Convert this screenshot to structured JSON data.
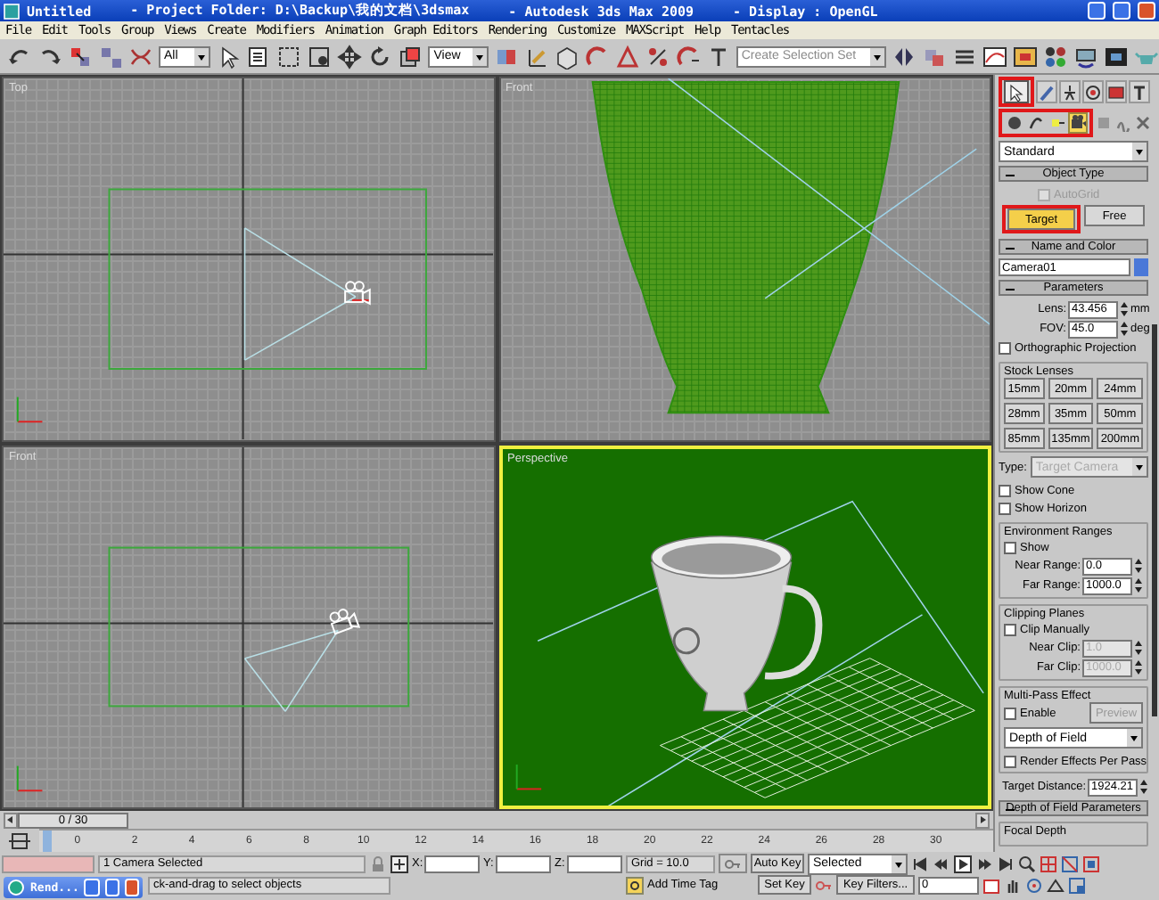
{
  "window": {
    "title_parts": [
      "Untitled",
      "- Project Folder: D:\\Backup\\我的文档\\3dsmax",
      "- Autodesk 3ds Max  2009",
      "- Display : OpenGL"
    ]
  },
  "menu": [
    "File",
    "Edit",
    "Tools",
    "Group",
    "Views",
    "Create",
    "Modifiers",
    "Animation",
    "Graph Editors",
    "Rendering",
    "Customize",
    "MAXScript",
    "Help",
    "Tentacles"
  ],
  "toolbar": {
    "selection_filter": "All",
    "reference_coordinates": "View",
    "selection_set": {
      "placeholder": "Create Selection Set"
    }
  },
  "viewports": [
    {
      "label": "Top",
      "kind": "top",
      "active": false
    },
    {
      "label": "Front",
      "kind": "front",
      "active": false
    },
    {
      "label": "Front",
      "kind": "side",
      "active": false
    },
    {
      "label": "Perspective",
      "kind": "perspective",
      "active": true
    }
  ],
  "command_panel": {
    "tabs": [
      {
        "selected": true,
        "highlighted": true
      },
      {
        "selected": false,
        "highlighted": false
      },
      {
        "selected": false,
        "highlighted": false
      },
      {
        "selected": false,
        "highlighted": false
      },
      {
        "selected": false,
        "highlighted": false
      },
      {
        "selected": false,
        "highlighted": false
      }
    ],
    "subtabs": [
      {
        "selected": false,
        "highlighted": true
      },
      {
        "selected": false,
        "highlighted": true
      },
      {
        "selected": false,
        "highlighted": true
      },
      {
        "selected": true,
        "highlighted": true
      },
      {
        "selected": false,
        "highlighted": false
      },
      {
        "selected": false,
        "highlighted": false
      },
      {
        "selected": false,
        "highlighted": false
      }
    ],
    "category": "Standard",
    "object_type": {
      "title": "Object Type",
      "autogrid": {
        "label": "AutoGrid",
        "checked": false,
        "disabled": true
      },
      "buttons": [
        {
          "label": "Target",
          "selected": true,
          "highlighted": true
        },
        {
          "label": "Free",
          "selected": false,
          "highlighted": false
        }
      ]
    },
    "name_and_color": {
      "title": "Name and Color",
      "name": "Camera01",
      "color": "#4a78d8"
    },
    "parameters": {
      "title": "Parameters",
      "lens": {
        "label": "Lens:",
        "value": "43.456",
        "unit": "mm",
        "disabled": false
      },
      "fov": {
        "label": "FOV:",
        "value": "45.0",
        "unit": "deg",
        "disabled": false
      },
      "orthographic": {
        "label": "Orthographic Projection",
        "checked": false,
        "disabled": false
      },
      "stock_lenses": {
        "title": "Stock Lenses",
        "buttons": [
          "15mm",
          "20mm",
          "24mm",
          "28mm",
          "35mm",
          "50mm",
          "85mm",
          "135mm",
          "200mm"
        ]
      },
      "type": {
        "label": "Type:",
        "value": "Target Camera",
        "disabled": true
      },
      "show_cone": {
        "label": "Show Cone",
        "checked": false,
        "disabled": false
      },
      "show_horizon": {
        "label": "Show Horizon",
        "checked": false,
        "disabled": false
      },
      "environment_ranges": {
        "title": "Environment Ranges",
        "show": {
          "label": "Show",
          "checked": false,
          "disabled": false
        },
        "near": {
          "label": "Near Range:",
          "value": "0.0",
          "disabled": false
        },
        "far": {
          "label": "Far Range:",
          "value": "1000.0",
          "disabled": false
        }
      },
      "clipping_planes": {
        "title": "Clipping Planes",
        "clip_manually": {
          "label": "Clip Manually",
          "checked": false,
          "disabled": false
        },
        "near": {
          "label": "Near Clip:",
          "value": "1.0",
          "disabled": true
        },
        "far": {
          "label": "Far Clip:",
          "value": "1000.0",
          "disabled": true
        }
      },
      "multi_pass": {
        "title": "Multi-Pass Effect",
        "enable": {
          "label": "Enable",
          "checked": false,
          "disabled": false
        },
        "preview": {
          "label": "Preview",
          "disabled": true
        },
        "effect": "Depth of Field",
        "render_per_pass": {
          "label": "Render Effects Per Pass",
          "checked": false,
          "disabled": false
        }
      },
      "target_distance": {
        "label": "Target Distance:",
        "value": "1924.21",
        "disabled": false
      }
    },
    "depth_of_field": {
      "title": "Depth of Field Parameters",
      "group": "Focal Depth"
    }
  },
  "time_slider": {
    "label": "0 / 30",
    "level": 0
  },
  "track_labels": [
    "0",
    "2",
    "4",
    "6",
    "8",
    "10",
    "12",
    "14",
    "16",
    "18",
    "20",
    "22",
    "24",
    "26",
    "28",
    "30"
  ],
  "status_bar": {
    "selection": "1 Camera Selected",
    "prompt": "ck-and-drag to select objects",
    "coordinates": [
      "X:",
      "Y:",
      "Z:"
    ],
    "grid": "Grid = 10.0",
    "add_time_tag": "Add Time Tag",
    "auto_key": "Auto Key",
    "set_key": "Set Key",
    "key_mode": "Selected",
    "key_filters": "Key Filters...",
    "frame": "0"
  },
  "taskbar_window": {
    "label": "Rend..."
  }
}
